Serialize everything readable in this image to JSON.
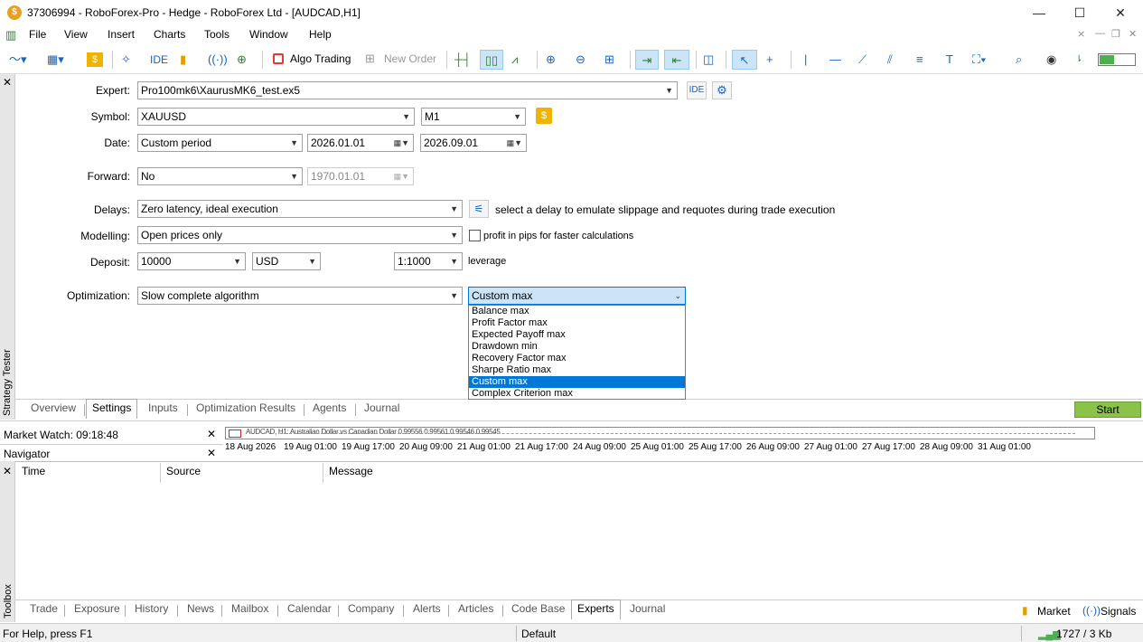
{
  "window": {
    "title": "37306994 - RoboForex-Pro - Hedge - RoboForex Ltd - [AUDCAD,H1]",
    "minimize_label": "—",
    "maximize_label": "☐",
    "close_label": "✕"
  },
  "menu": {
    "items": [
      "File",
      "View",
      "Insert",
      "Charts",
      "Tools",
      "Window",
      "Help"
    ]
  },
  "toolbar": {
    "ide_label": "IDE",
    "algo_trading_label": "Algo Trading",
    "new_order_label": "New Order"
  },
  "form": {
    "expert": {
      "label": "Expert:",
      "value": "Pro100mk6\\XaurusMK6_test.ex5",
      "ide_button": "IDE"
    },
    "symbol": {
      "label": "Symbol:",
      "value": "XAUUSD",
      "timeframe": "M1"
    },
    "date": {
      "label": "Date:",
      "period": "Custom period",
      "from": "2026.01.01",
      "to": "2026.09.01"
    },
    "forward": {
      "label": "Forward:",
      "value": "No",
      "date": "1970.01.01"
    },
    "delays": {
      "label": "Delays:",
      "value": "Zero latency, ideal execution",
      "hint": "select a delay to emulate slippage and requotes during trade execution"
    },
    "modelling": {
      "label": "Modelling:",
      "value": "Open prices only",
      "checkbox_label": "profit in pips for faster calculations"
    },
    "deposit": {
      "label": "Deposit:",
      "value": "10000",
      "currency": "USD",
      "leverage": "1:1000",
      "leverage_label": "leverage"
    },
    "optimization": {
      "label": "Optimization:",
      "value": "Slow complete algorithm",
      "criterion": "Custom max",
      "options": [
        "Balance max",
        "Profit Factor max",
        "Expected Payoff max",
        "Drawdown min",
        "Recovery Factor max",
        "Sharpe Ratio max",
        "Custom max",
        "Complex Criterion max"
      ],
      "selected_index": 6
    }
  },
  "tester_tabs": [
    "Overview",
    "Settings",
    "Inputs",
    "Optimization Results",
    "Agents",
    "Journal"
  ],
  "tester_active_tab": "Settings",
  "start_label": "Start",
  "side_strip_label": "Strategy Tester",
  "market_watch": {
    "title": "Market Watch: 09:18:48"
  },
  "navigator": {
    "title": "Navigator"
  },
  "chart": {
    "overlay_text": "AUDCAD, H1: Australian Dollar vs Canadian Dollar  0.99556 0.99561 0.99546 0.99545",
    "x_labels": [
      "18 Aug 2026",
      "19 Aug 01:00",
      "19 Aug 17:00",
      "20 Aug 09:00",
      "21 Aug 01:00",
      "21 Aug 17:00",
      "24 Aug 09:00",
      "25 Aug 01:00",
      "25 Aug 17:00",
      "26 Aug 09:00",
      "27 Aug 01:00",
      "27 Aug 17:00",
      "28 Aug 09:00",
      "31 Aug 01:00"
    ]
  },
  "journal": {
    "columns": [
      "Time",
      "Source",
      "Message"
    ]
  },
  "toolbox_label": "Toolbox",
  "toolbox_tabs": [
    "Trade",
    "Exposure",
    "History",
    "News",
    "Mailbox",
    "Calendar",
    "Company",
    "Alerts",
    "Articles",
    "Code Base",
    "Experts",
    "Journal"
  ],
  "toolbox_active_tab": "Experts",
  "toolbox_right": {
    "market": "Market",
    "signals": "Signals"
  },
  "status": {
    "help": "For Help, press F1",
    "profile": "Default",
    "traffic": "1727 / 3 Kb"
  },
  "colors": {
    "selection": "#0078d7",
    "start": "#8bc34a",
    "accent": "#1565c0"
  }
}
